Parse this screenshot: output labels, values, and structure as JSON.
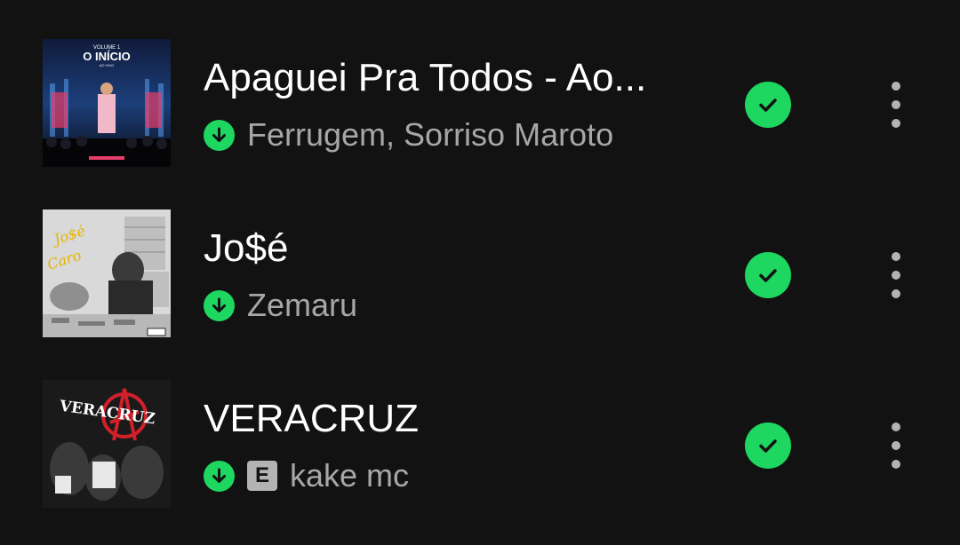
{
  "tracks": [
    {
      "title": "Apaguei Pra Todos - Ao...",
      "artist": "Ferrugem, Sorriso Maroto",
      "explicit": false,
      "downloaded": true,
      "saved": true,
      "cover_text": {
        "line1": "VOLUME 1",
        "line2": "O INÍCIO",
        "line3": "AO VIVO"
      }
    },
    {
      "title": "Jo$é",
      "artist": "Zemaru",
      "explicit": false,
      "downloaded": true,
      "saved": true,
      "cover_text": {
        "line1": "Jo$é",
        "line2": "Caro"
      }
    },
    {
      "title": "VERACRUZ",
      "artist": "kake mc",
      "explicit": true,
      "explicit_label": "E",
      "downloaded": true,
      "saved": true,
      "cover_text": {
        "line1": "VERACRUZ"
      }
    }
  ],
  "colors": {
    "background": "#121212",
    "accent": "#1ed760",
    "secondary_text": "#a7a7a7",
    "primary_text": "#ffffff"
  },
  "icons": {
    "download": "arrow-down-circle-icon",
    "saved": "check-circle-icon",
    "more": "vertical-ellipsis-icon",
    "explicit": "explicit-badge-icon"
  }
}
